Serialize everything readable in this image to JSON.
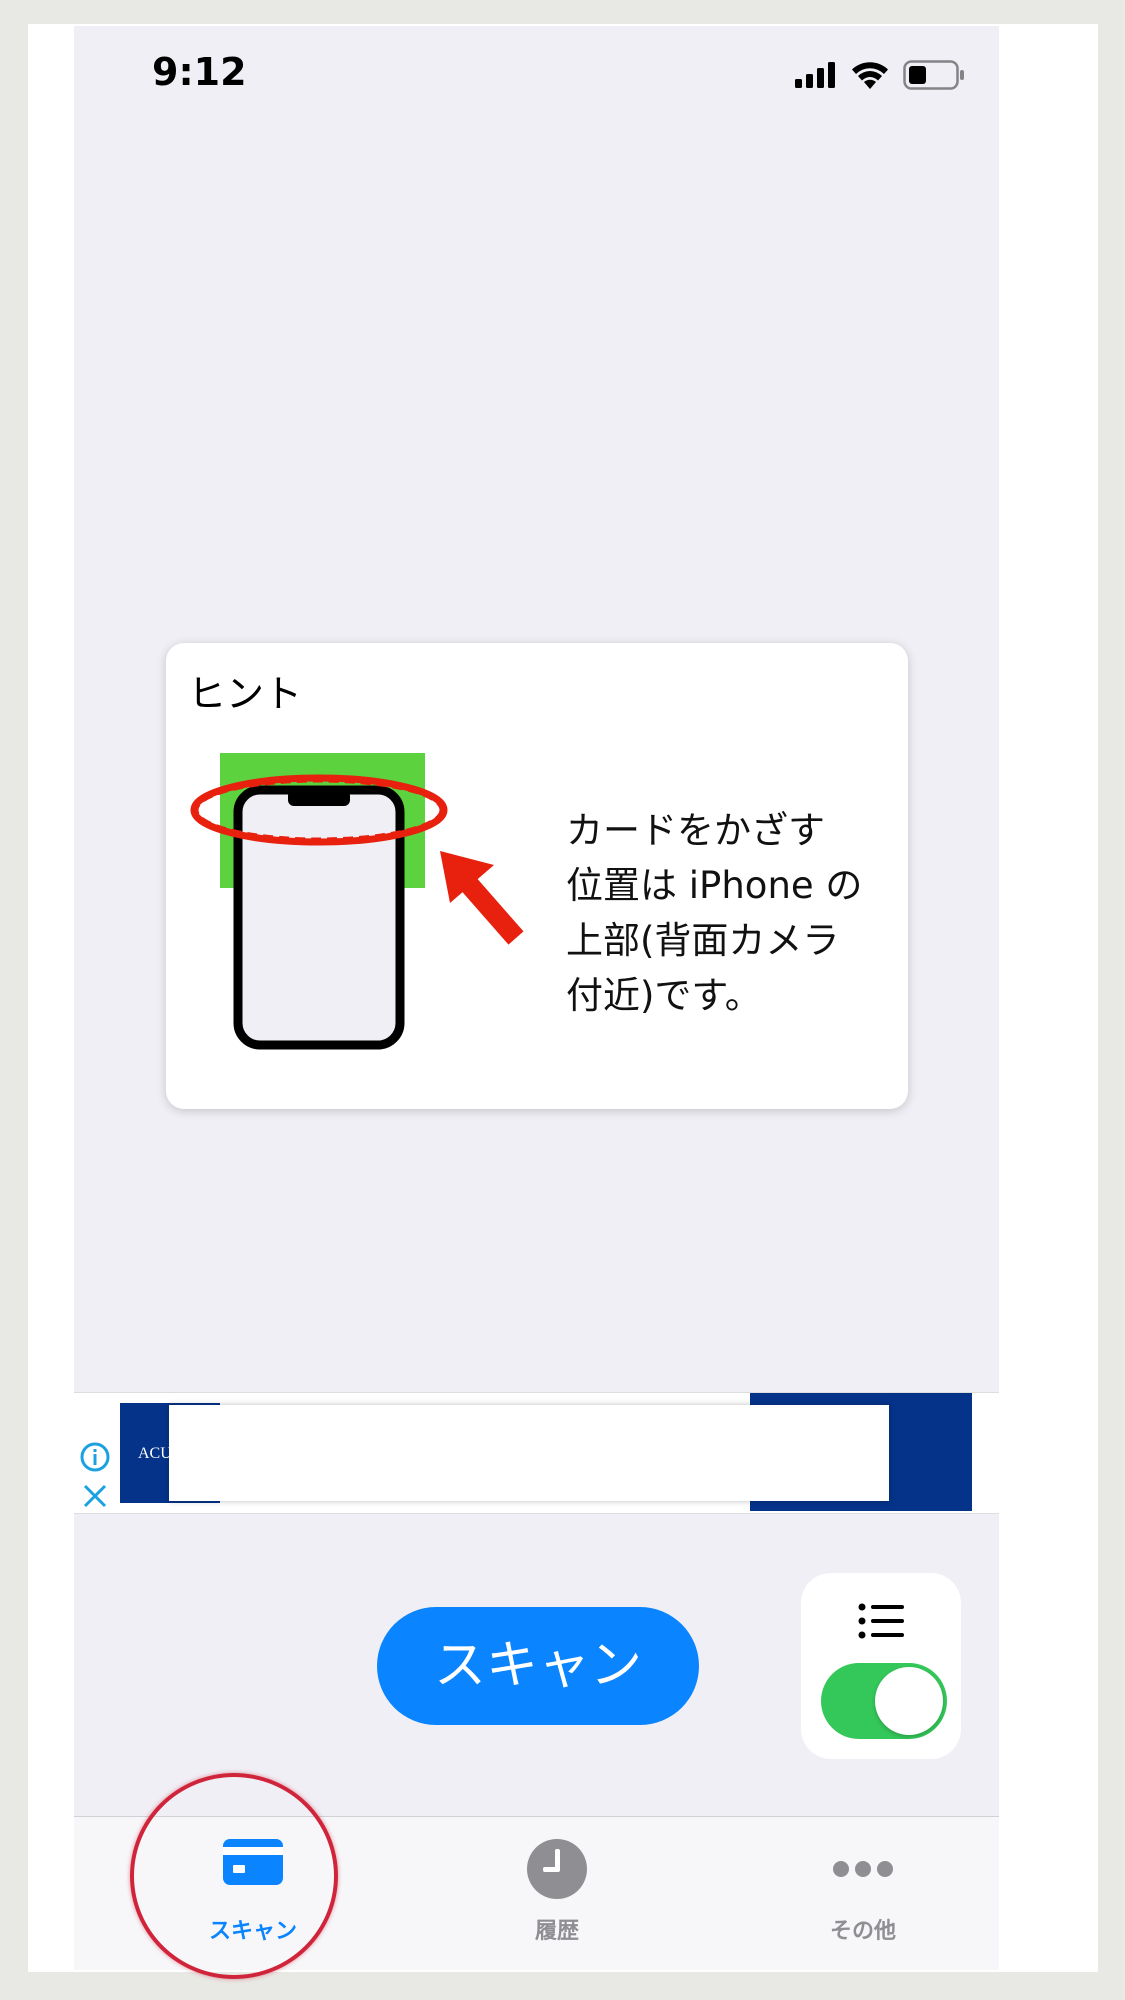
{
  "status_bar": {
    "time": "9:12"
  },
  "hint": {
    "title": "ヒント",
    "message": "カードをかざす\n位置は iPhone の\n上部(背面カメラ\n付近)です。"
  },
  "ad": {
    "brand_text": "ACU"
  },
  "scan_button": {
    "label": "スキャン"
  },
  "list_toggle": {
    "on": true
  },
  "tabs": [
    {
      "label": "スキャン",
      "icon": "card-icon",
      "active": true
    },
    {
      "label": "履歴",
      "icon": "clock-icon",
      "active": false
    },
    {
      "label": "その他",
      "icon": "more-icon",
      "active": false
    }
  ],
  "colors": {
    "accent": "#0a84ff",
    "toggle_on": "#34c759",
    "inactive_tab": "#8e8e93",
    "highlight": "#d0243a",
    "card_green": "#5cd23f",
    "arrow_red": "#e8200e"
  }
}
